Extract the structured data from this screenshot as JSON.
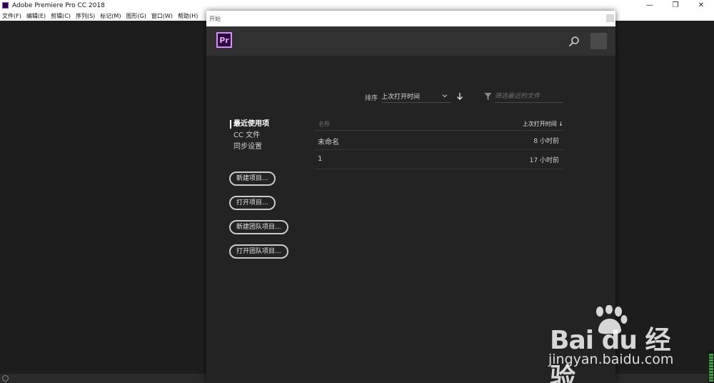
{
  "window": {
    "title": "Adobe Premiere Pro CC 2018",
    "minimize_glyph": "—",
    "maximize_glyph": "❐",
    "close_glyph": "✕"
  },
  "menubar": [
    "文件(F)",
    "编辑(E)",
    "剪辑(C)",
    "序列(S)",
    "标记(M)",
    "图形(G)",
    "窗口(W)",
    "帮助(H)"
  ],
  "dialog": {
    "title": "开始",
    "logo_text": "Pr",
    "sort": {
      "label": "排序",
      "value": "上次打开时间"
    },
    "filter": {
      "placeholder": "筛选最近的文件"
    },
    "nav": [
      {
        "label": "最近使用项",
        "active": true
      },
      {
        "label": "CC 文件",
        "active": false
      },
      {
        "label": "同步设置",
        "active": false
      }
    ],
    "buttons": [
      "新建项目...",
      "打开项目...",
      "新建团队项目...",
      "打开团队项目..."
    ],
    "table": {
      "columns": {
        "name": "名称",
        "time": "上次打开时间 ↓"
      },
      "rows": [
        {
          "name": "未命名",
          "time": "8 小时前"
        },
        {
          "name": "1",
          "time": "17 小时前"
        }
      ]
    }
  },
  "watermark": {
    "brand": "Bai du 经验",
    "url": "jingyan.baidu.com"
  },
  "icons": {
    "app": "premiere-app-icon",
    "search": "search-icon",
    "filter": "filter-icon",
    "sort_direction": "arrow-down-icon",
    "dropdown": "chevron-down-icon"
  },
  "colors": {
    "workspace": "#1d1d1d",
    "dialog": "#232323",
    "header": "#313131",
    "pr_accent": "#d88dff",
    "meter": "#3ea142"
  }
}
